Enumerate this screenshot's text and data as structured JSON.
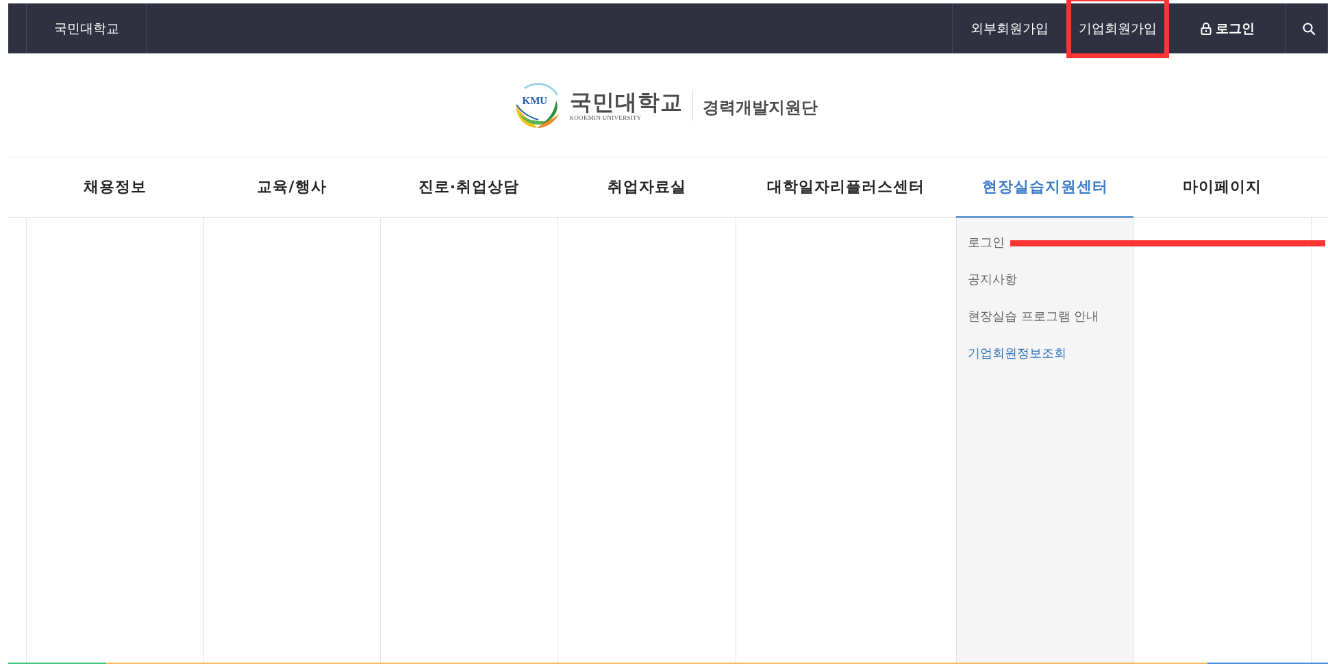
{
  "top_bar": {
    "home_link": "국민대학교",
    "links": [
      {
        "label": "외부회원가입",
        "highlighted": false
      },
      {
        "label": "기업회원가입",
        "highlighted": true
      }
    ],
    "login": "로그인"
  },
  "logo": {
    "emblem_text": "KMU",
    "name": "국민대학교",
    "name_en": "KOOKMIN UNIVERSITY",
    "department": "경력개발지원단"
  },
  "nav": {
    "tabs": [
      {
        "label": "채용정보",
        "selected": false
      },
      {
        "label": "교육/행사",
        "selected": false
      },
      {
        "label": "진로·취업상담",
        "selected": false
      },
      {
        "label": "취업자료실",
        "selected": false
      },
      {
        "label": "대학일자리플러스센터",
        "selected": false
      },
      {
        "label": "현장실습지원센터",
        "selected": true,
        "submenu": [
          {
            "label": "로그인",
            "selected": false,
            "marked": true
          },
          {
            "label": "공지사항",
            "selected": false,
            "marked": false
          },
          {
            "label": "현장실습 프로그램 안내",
            "selected": false,
            "marked": false
          },
          {
            "label": "기업회원정보조회",
            "selected": true,
            "marked": false
          }
        ]
      },
      {
        "label": "마이페이지",
        "selected": false
      }
    ]
  }
}
